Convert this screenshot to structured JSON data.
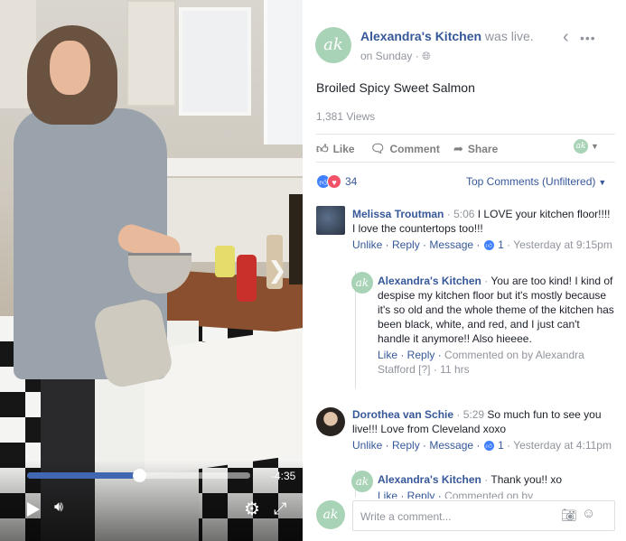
{
  "video": {
    "time_remaining": "-4:35",
    "progress_fraction": 0.5,
    "controls": {
      "play_icon": "play-icon",
      "volume_icon": "volume-icon",
      "settings_icon": "gear-icon",
      "fullscreen_icon": "expand-icon",
      "next_icon": "chevron-right-icon"
    }
  },
  "header": {
    "page_name": "Alexandra's Kitchen",
    "status": " was live.",
    "timestamp": "on Sunday",
    "separator": " · ",
    "avatar_text": "ak"
  },
  "post": {
    "title": "Broiled Spicy Sweet Salmon",
    "views": "1,381 Views"
  },
  "actions": {
    "like": "Like",
    "comment": "Comment",
    "share": "Share"
  },
  "reactions": {
    "count": "34",
    "sort_label": "Top Comments (Unfiltered)"
  },
  "comments": [
    {
      "author": "Melissa Troutman",
      "time": "5:06",
      "text": "I LOVE your kitchen floor!!!! I love the countertops too!!!",
      "actions": "Unlike · Reply · Message ·",
      "likes": "1",
      "meta": "Yesterday at 9:15pm"
    },
    {
      "author": "Alexandra's Kitchen",
      "text": "You are too kind! I kind of despise my kitchen floor but it's mostly because it's so old and the whole theme of the kitchen has been black, white, and red, and I just can't handle it anymore!! Also hieeee.",
      "actions": "Like · Reply ·",
      "meta": "Commented on by Alexandra Stafford [?] · 11 hrs"
    },
    {
      "author": "Dorothea van Schie",
      "time": "5:29",
      "text": "So much fun to see you live!!! Love from Cleveland xoxo",
      "actions": "Unlike · Reply · Message ·",
      "likes": "1",
      "meta": "Yesterday at 4:11pm"
    },
    {
      "author": "Alexandra's Kitchen",
      "text": "Thank you!! xo",
      "actions": "Like · Reply ·",
      "meta": "Commented on by"
    }
  ],
  "compose": {
    "placeholder": "Write a comment..."
  }
}
